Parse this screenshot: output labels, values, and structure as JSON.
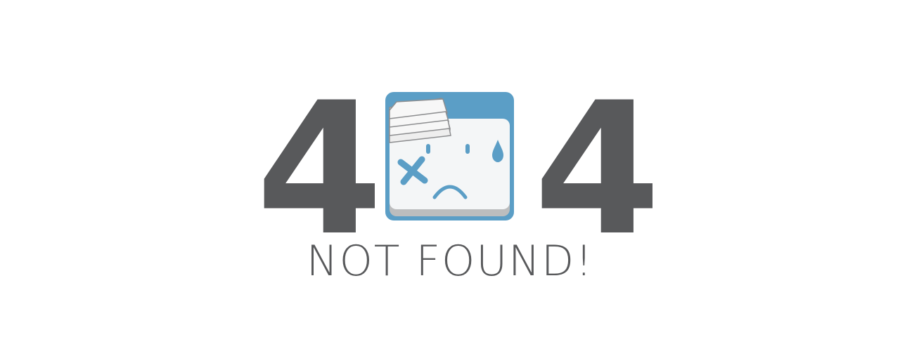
{
  "error": {
    "digit_left": "4",
    "digit_right": "4",
    "message": "NOT FOUND!"
  },
  "icons": {
    "center": "bandaged-sad-face-icon"
  },
  "colors": {
    "digit": "#58595b",
    "icon_frame": "#5b9ec6",
    "icon_face": "#f4f6f7",
    "icon_accent": "#5b9ec6",
    "background": "#ffffff"
  }
}
